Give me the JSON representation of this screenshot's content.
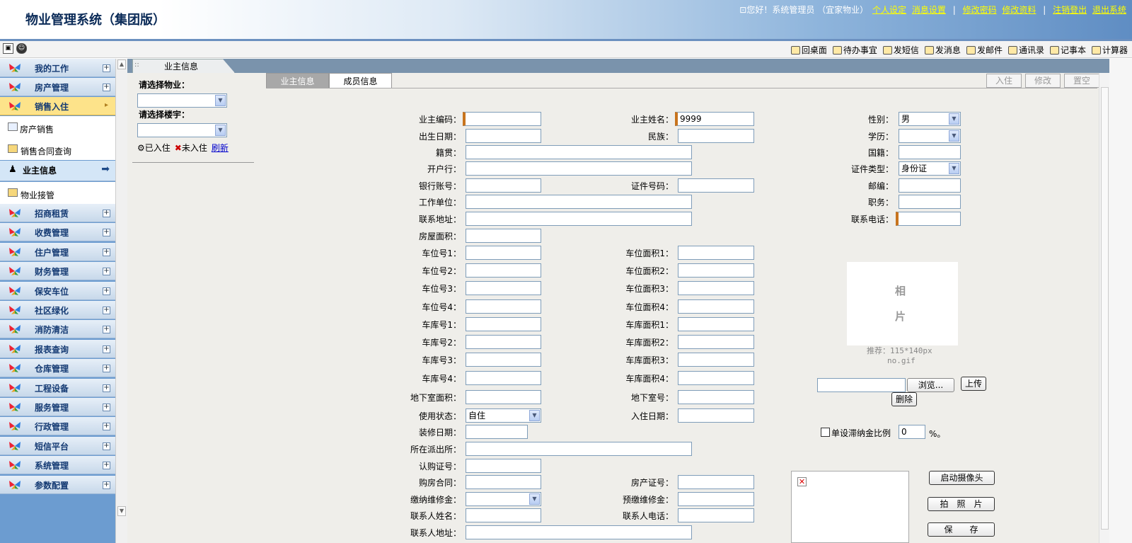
{
  "header": {
    "title": "物业管理系统（集团版）",
    "greeting": "您好！系统管理员 （宜家物业）",
    "links": [
      "个人设定",
      "消息设置",
      "修改密码",
      "修改资料",
      "注销登出",
      "退出系统"
    ]
  },
  "toolbar": {
    "items": [
      "回桌面",
      "待办事宜",
      "发短信",
      "发消息",
      "发邮件",
      "通讯录",
      "记事本",
      "计算器"
    ]
  },
  "sidebar": {
    "top_items": [
      "我的工作",
      "房产管理"
    ],
    "selected": "销售入住",
    "sub_items": [
      "房产销售",
      "销售合同查询"
    ],
    "current": "业主信息",
    "sub_items2": [
      "物业接管"
    ],
    "items": [
      "招商租赁",
      "收费管理",
      "住户管理",
      "财务管理",
      "保安车位",
      "社区绿化",
      "消防清洁",
      "报表查询",
      "仓库管理",
      "工程设备",
      "服务管理",
      "行政管理",
      "短信平台",
      "系统管理",
      "参数配置"
    ]
  },
  "tab": {
    "label": "业主信息"
  },
  "left_panel": {
    "property_label": "请选择物业：",
    "building_label": "请选择楼宇：",
    "occupied": "已入住",
    "not_occupied": "未入住",
    "refresh": "刷新"
  },
  "form_tabs": [
    "业主信息",
    "成员信息"
  ],
  "action_buttons": [
    "入住",
    "修改",
    "置空"
  ],
  "form": {
    "owner_code": "业主编码：",
    "owner_name": "业主姓名：",
    "owner_name_value": "9999",
    "gender": "性别：",
    "gender_value": "男",
    "birth": "出生日期：",
    "ethnicity": "民族：",
    "education": "学历：",
    "native_place": "籍贯：",
    "nationality": "国籍：",
    "bank": "开户行：",
    "id_type": "证件类型：",
    "id_type_value": "身份证",
    "bank_account": "银行账号：",
    "id_no": "证件号码：",
    "postcode": "邮编：",
    "employer": "工作单位：",
    "position": "职务：",
    "address": "联系地址：",
    "phone": "联系电话：",
    "house_area": "房屋面积：",
    "parking_no_1": "车位号1：",
    "parking_no_2": "车位号2：",
    "parking_no_3": "车位号3：",
    "parking_no_4": "车位号4：",
    "parking_area_1": "车位面积1：",
    "parking_area_2": "车位面积2：",
    "parking_area_3": "车位面积3：",
    "parking_area_4": "车位面积4：",
    "garage_no_1": "车库号1：",
    "garage_no_2": "车库号2：",
    "garage_no_3": "车库号3：",
    "garage_no_4": "车库号4：",
    "garage_area_1": "车库面积1：",
    "garage_area_2": "车库面积2：",
    "garage_area_3": "车库面积3：",
    "garage_area_4": "车库面积4：",
    "basement_area": "地下室面积：",
    "basement_no": "地下室号：",
    "use_status": "使用状态：",
    "use_status_value": "自住",
    "move_in_date": "入住日期：",
    "decor_date": "装修日期：",
    "police_station": "所在派出所：",
    "subscription_no": "认购证号：",
    "purchase_contract": "购房合同：",
    "property_cert": "房产证号：",
    "maintenance_fee": "缴纳维修金：",
    "prepaid_maintenance": "预缴维修金：",
    "contact_name": "联系人姓名：",
    "contact_phone": "联系人电话：",
    "contact_address": "联系人地址："
  },
  "photo": {
    "char1": "相",
    "char2": "片",
    "recommend": "推荐：115*140px",
    "filename": "no.gif",
    "browse": "浏览...",
    "upload": "上传",
    "delete": "删除",
    "late_fee_label": "单设滞纳金比例",
    "late_fee_value": "0",
    "late_fee_unit": "%。",
    "start_camera": "启动摄像头",
    "take_photo": "拍　照　片",
    "save": "保　　存"
  }
}
